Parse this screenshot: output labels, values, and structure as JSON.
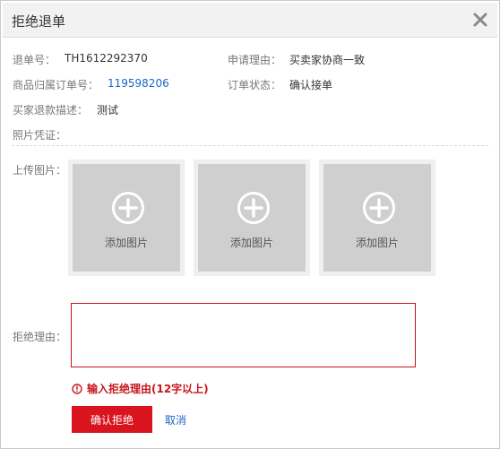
{
  "dialog": {
    "title": "拒绝退单"
  },
  "info": {
    "refund_no_label": "退单号：",
    "refund_no_value": "TH1612292370",
    "apply_reason_label": "申请理由：",
    "apply_reason_value": "买卖家协商一致",
    "order_no_label": "商品归属订单号：",
    "order_no_value": "119598206",
    "order_status_label": "订单状态：",
    "order_status_value": "确认接单",
    "buyer_desc_label": "买家退款描述：",
    "buyer_desc_value": "测试",
    "photo_proof_label": "照片凭证："
  },
  "upload": {
    "label": "上传图片：",
    "slots": [
      {
        "text": "添加图片"
      },
      {
        "text": "添加图片"
      },
      {
        "text": "添加图片"
      }
    ]
  },
  "reason": {
    "label": "拒绝理由：",
    "value": "",
    "error": "输入拒绝理由(12字以上)"
  },
  "actions": {
    "confirm_label": "确认拒绝",
    "cancel_label": "取消"
  },
  "colors": {
    "accent_red": "#d9141e",
    "link_blue": "#1a66c8"
  },
  "icons": [
    "close-icon",
    "plus-circle-icon",
    "error-circle-icon"
  ]
}
